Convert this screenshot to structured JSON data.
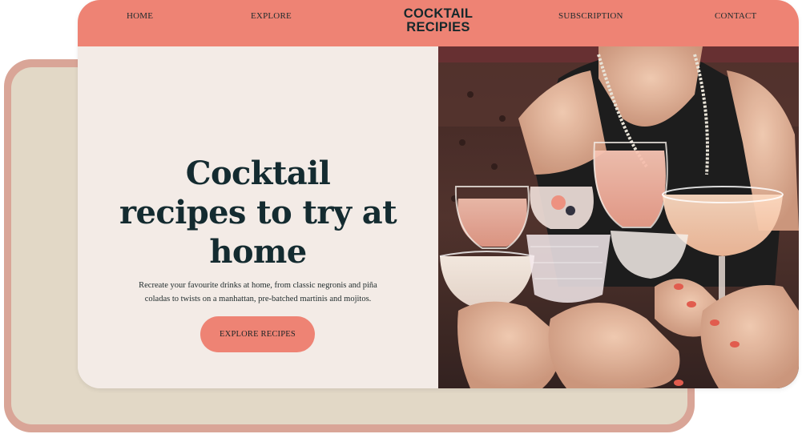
{
  "nav": {
    "home": "HOME",
    "explore": "EXPLORE",
    "logo_line1": "COCKTAIL",
    "logo_line2": "RECIPIES",
    "subscription": "SUBSCRIPTION",
    "contact": "CONTACT"
  },
  "hero": {
    "title_line1": "Cocktail",
    "title_line2": "recipes to try at",
    "title_line3": "home",
    "subtitle_line1": "Recreate your favourite drinks at home, from classic negronis and piña",
    "subtitle_line2": "coladas to twists on a manhattan, pre-batched martinis and mojitos.",
    "cta_label": "EXPLORE RECIPES"
  },
  "colors": {
    "accent": "#ee8374",
    "hero_bg": "#f3ebe6",
    "heading": "#142b30",
    "back_card_border": "#d9a597",
    "back_card_fill": "#e2d8c6"
  },
  "photo": {
    "subject": "cocktail-glasses-toast-photo"
  }
}
